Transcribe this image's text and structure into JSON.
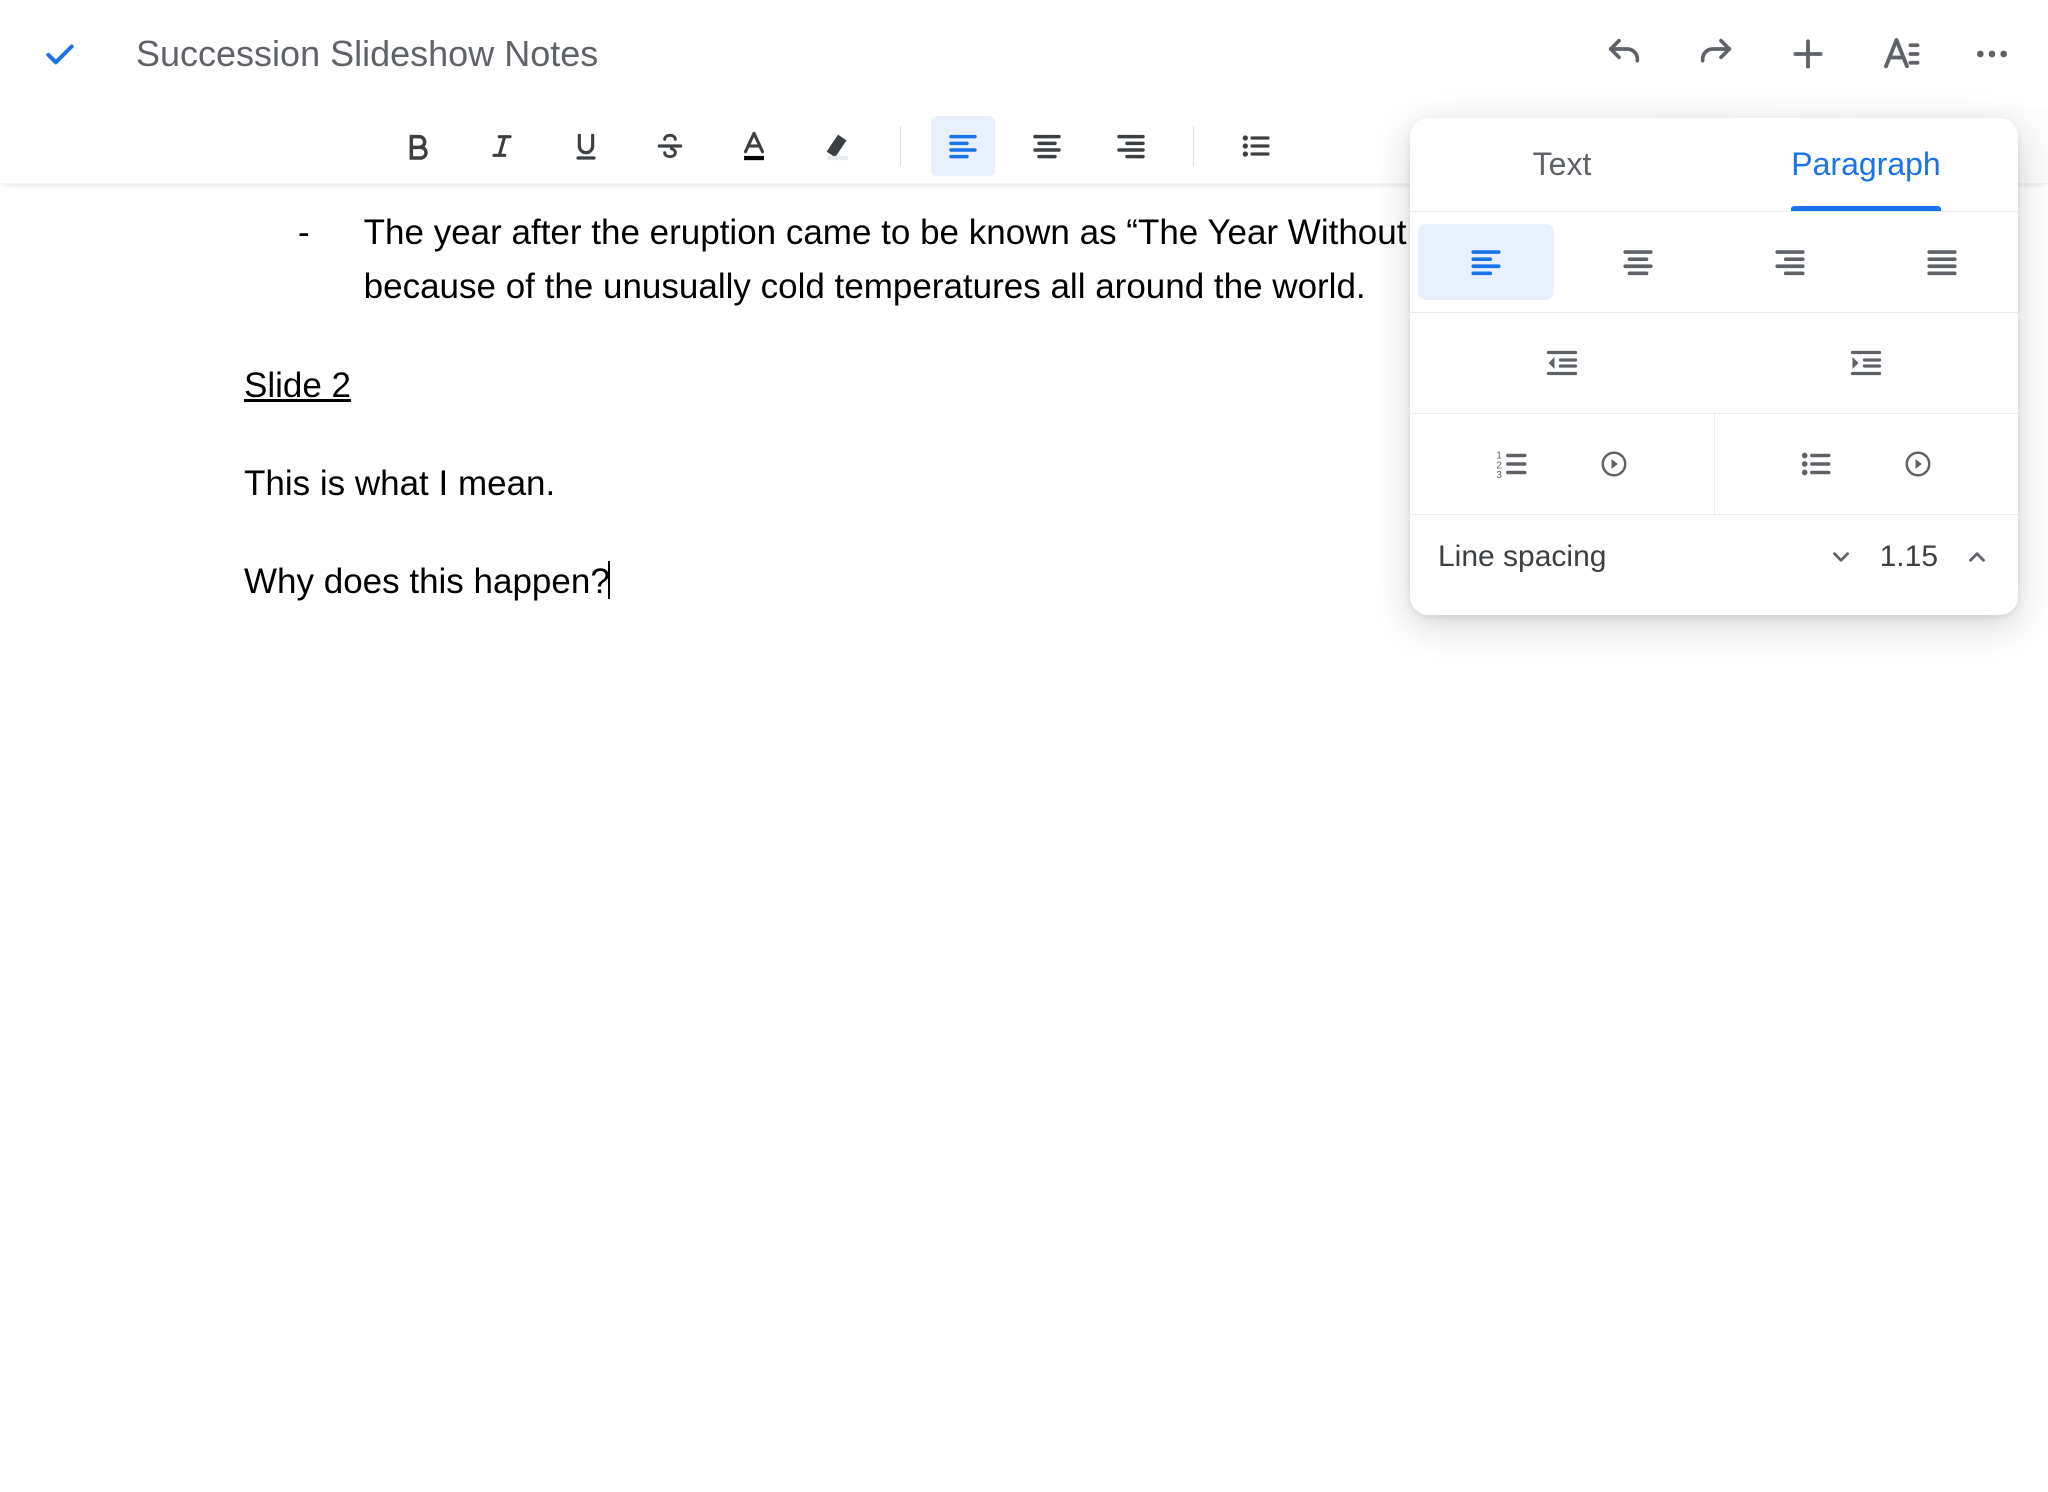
{
  "header": {
    "title": "Succession Slideshow Notes"
  },
  "doc": {
    "bullet_dash": "-",
    "bullet_text": "The year after the eruption came to be known as “The Year Without A Summer” because of the unusually cold temperatures all around the world.",
    "slide_heading": "Slide 2",
    "para1": "This is what I mean.",
    "para2": "Why does this happen?"
  },
  "panel": {
    "tabs": {
      "text": "Text",
      "paragraph": "Paragraph"
    },
    "line_spacing_label": "Line spacing",
    "line_spacing_value": "1.15"
  }
}
